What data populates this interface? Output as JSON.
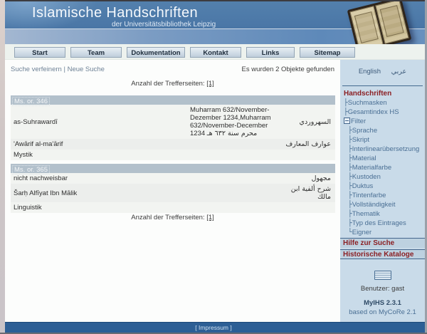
{
  "header": {
    "title": "Islamische Handschriften",
    "subtitle": "der Universitätsbibliothek Leipzig"
  },
  "tabs": [
    "Start",
    "Team",
    "Dokumentation",
    "Kontakt",
    "Links",
    "Sitemap"
  ],
  "toolbar": {
    "refine_link": "Suche verfeinern",
    "separator": "|",
    "new_search_link": "Neue Suche",
    "result_count": "Es wurden 2 Objekte gefunden",
    "pages_label": "Anzahl der Trefferseiten:",
    "pages_link": "[1]"
  },
  "records": [
    {
      "shelfmark": "Ms. or. 346",
      "author": "as-Suhrawardī",
      "author_ar": "السهروردي",
      "date": "Muharram 632/November-Dezember 1234,Muharram 632/November-December 1234",
      "date_ar": "محرم سنة ٦٣٢ هـ",
      "title": "'Awārif al-ma'ārif",
      "title_ar": "عوارف المعارف",
      "subject": "Mystik"
    },
    {
      "shelfmark": "Ms. or. 365",
      "author": "nicht nachweisbar",
      "author_ar": "مجهول",
      "title": "Šarḥ Alfīyat Ibn Mālik",
      "title_ar": "شرح ألفية ابن مالك",
      "subject": "Linguistik"
    }
  ],
  "sidebar": {
    "languages": [
      "English",
      "عربي"
    ],
    "section_title": "Handschriften",
    "items": [
      "Suchmasken",
      "Gesamtindex HS"
    ],
    "filter_label": "Filter",
    "filter_items": [
      "Sprache",
      "Skript",
      "Interlinearübersetzung",
      "Material",
      "Materialfarbe",
      "Kustoden",
      "Duktus",
      "Tintenfarbe",
      "Vollständigkeit",
      "Thematik",
      "Typ des Eintrages",
      "Eigner"
    ],
    "help_title": "Hilfe zur Suche",
    "catalogs_title": "Historische Kataloge",
    "user": "Benutzer: gast",
    "version": "MyIHS 2.3.1",
    "based_on": "based on MyCoRe 2.1"
  },
  "footer": {
    "impressum": "[ Impressum ]"
  },
  "colors": {
    "header_blue": "#4a76a6",
    "band_blue": "#5e89b9",
    "sidebar_bg": "#c9dbe9",
    "section_red": "#8b2024",
    "record_bar": "#b2c0cb",
    "footer_blue": "#2d5f95"
  }
}
